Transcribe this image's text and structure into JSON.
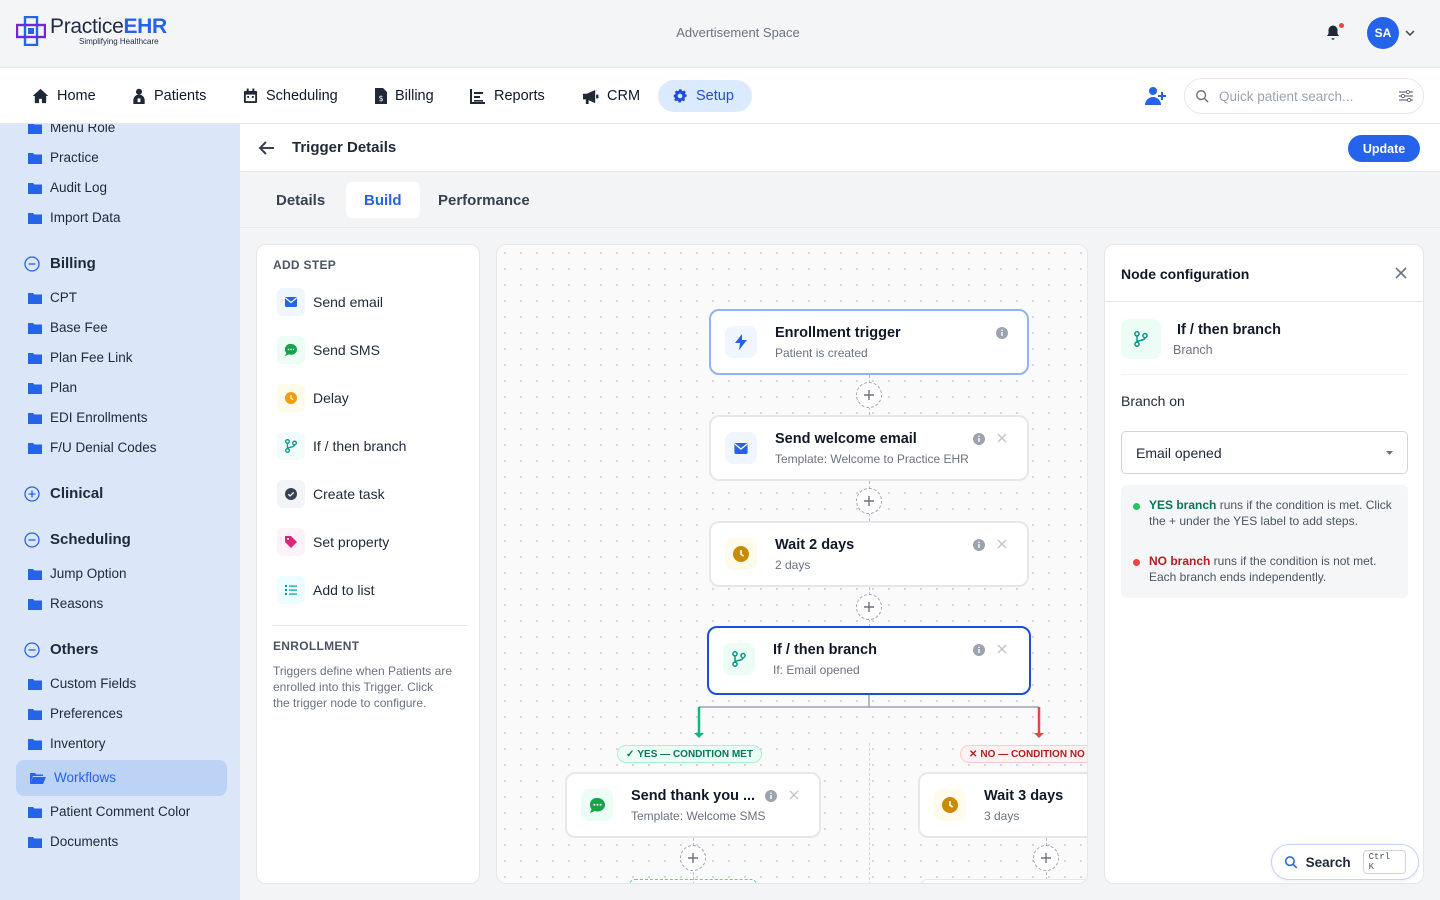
{
  "brand": {
    "name_a": "Practice",
    "name_b": "EHR",
    "tagline": "Simplifying Healthcare"
  },
  "header": {
    "ad": "Advertisement Space",
    "avatar_initials": "SA"
  },
  "nav": {
    "items": [
      {
        "label": "Home",
        "icon": "home-icon"
      },
      {
        "label": "Patients",
        "icon": "patient-icon"
      },
      {
        "label": "Scheduling",
        "icon": "calendar-icon"
      },
      {
        "label": "Billing",
        "icon": "billing-icon"
      },
      {
        "label": "Reports",
        "icon": "reports-icon"
      },
      {
        "label": "CRM",
        "icon": "megaphone-icon"
      },
      {
        "label": "Setup",
        "icon": "gear-icon",
        "active": true
      }
    ],
    "search_placeholder": "Quick patient search..."
  },
  "sidebar": {
    "top_items": [
      "Menu Role",
      "Practice",
      "Audit Log",
      "Import Data"
    ],
    "sections": [
      {
        "title": "Billing",
        "expanded": true,
        "items": [
          "CPT",
          "Base Fee",
          "Plan Fee Link",
          "Plan",
          "EDI Enrollments",
          "F/U Denial Codes"
        ]
      },
      {
        "title": "Clinical",
        "expanded": false,
        "items": []
      },
      {
        "title": "Scheduling",
        "expanded": true,
        "items": [
          "Jump Option",
          "Reasons"
        ]
      },
      {
        "title": "Others",
        "expanded": true,
        "items": [
          "Custom Fields",
          "Preferences",
          "Inventory",
          "Workflows",
          "Patient Comment Color",
          "Documents"
        ]
      }
    ],
    "active_item": "Workflows"
  },
  "page": {
    "title": "Trigger Details",
    "update_label": "Update",
    "tabs": [
      "Details",
      "Build",
      "Performance"
    ],
    "active_tab": "Build"
  },
  "add_step": {
    "heading": "ADD STEP",
    "steps": [
      {
        "label": "Send email",
        "icon": "mail-icon",
        "color": "#2563eb"
      },
      {
        "label": "Send SMS",
        "icon": "chat-icon",
        "color": "#16a34a"
      },
      {
        "label": "Delay",
        "icon": "clock-icon",
        "color": "#f59e0b"
      },
      {
        "label": "If / then branch",
        "icon": "branch-icon",
        "color": "#0d9488"
      },
      {
        "label": "Create task",
        "icon": "check-circle-icon",
        "color": "#374151"
      },
      {
        "label": "Set property",
        "icon": "tag-icon",
        "color": "#db2777"
      },
      {
        "label": "Add to list",
        "icon": "list-icon",
        "color": "#0891b2"
      }
    ],
    "enrollment_heading": "ENROLLMENT",
    "enrollment_text": "Triggers define when Patients are enrolled into this Trigger. Click the trigger node to configure."
  },
  "flow": {
    "nodes": [
      {
        "title": "Enrollment trigger",
        "sub": "Patient is created",
        "icon": "bolt-icon"
      },
      {
        "title": "Send welcome email",
        "sub": "Template: Welcome to Practice EHR",
        "icon": "mail-icon"
      },
      {
        "title": "Wait 2 days",
        "sub": "2 days",
        "icon": "clock-icon"
      },
      {
        "title": "If / then branch",
        "sub": "If: Email opened",
        "icon": "branch-icon"
      },
      {
        "title": "Send thank you ...",
        "sub": "Template: Welcome SMS",
        "icon": "chat-icon"
      },
      {
        "title": "Wait 3 days",
        "sub": "3 days",
        "icon": "clock-icon"
      }
    ],
    "yes_label": "YES — CONDITION MET",
    "no_label": "NO — CONDITION NO"
  },
  "config": {
    "title": "Node configuration",
    "node_title": "If / then branch",
    "node_type": "Branch",
    "branch_on_label": "Branch on",
    "branch_on_value": "Email opened",
    "yes_strong": "YES branch",
    "yes_text": " runs if the condition is met. Click the + under the YES label to add steps.",
    "no_strong": "NO branch",
    "no_text": " runs if the condition is not met. Each branch ends independently."
  },
  "float_search": {
    "label": "Search",
    "shortcut": "Ctrl K"
  },
  "colors": {
    "accent": "#2563eb",
    "yes": "#10b981",
    "no": "#ef4444"
  }
}
